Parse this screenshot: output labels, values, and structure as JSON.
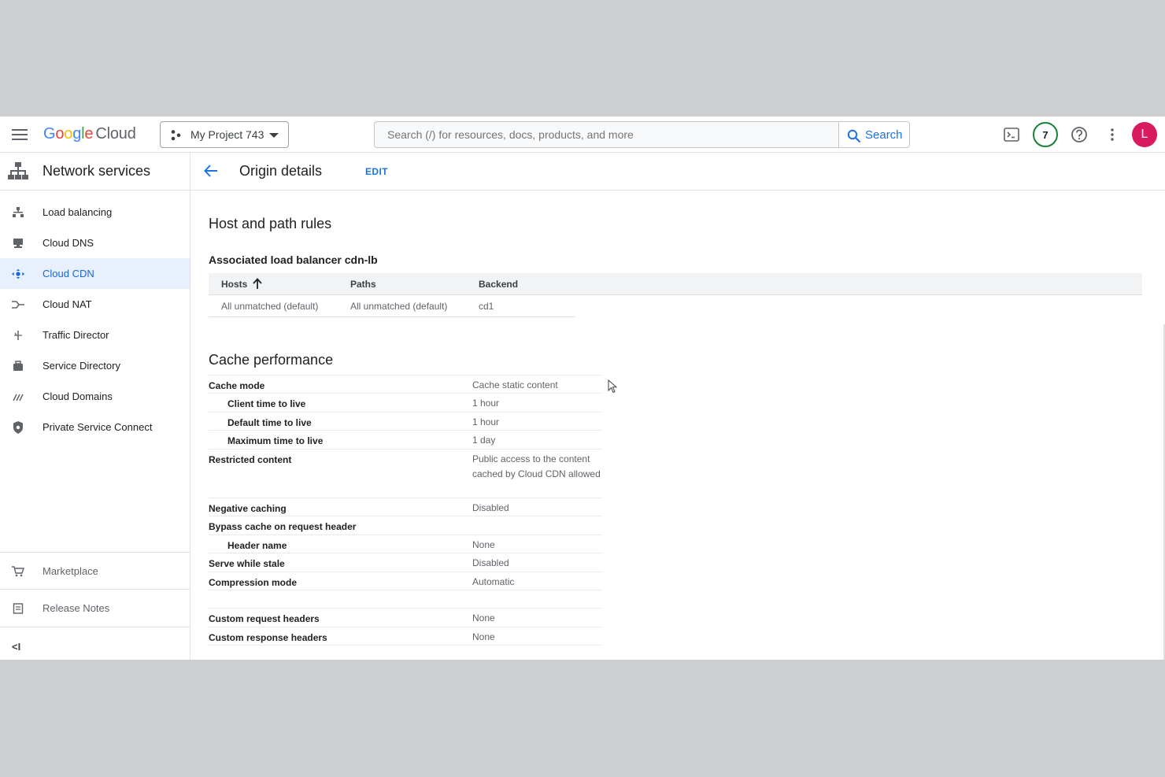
{
  "topbar": {
    "logo": {
      "letters": [
        "G",
        "o",
        "o",
        "g",
        "l",
        "e"
      ],
      "suffix": "Cloud"
    },
    "project_name": "My Project 743",
    "search_placeholder": "Search (/) for resources, docs, products, and more",
    "search_button": "Search",
    "notifications_count": "7",
    "avatar_letter": "L"
  },
  "sidebar": {
    "title": "Network services",
    "items": [
      {
        "label": "Load balancing",
        "icon": "load-balancing-icon"
      },
      {
        "label": "Cloud DNS",
        "icon": "cloud-dns-icon"
      },
      {
        "label": "Cloud CDN",
        "icon": "cloud-cdn-icon",
        "active": true
      },
      {
        "label": "Cloud NAT",
        "icon": "cloud-nat-icon"
      },
      {
        "label": "Traffic Director",
        "icon": "traffic-director-icon"
      },
      {
        "label": "Service Directory",
        "icon": "service-directory-icon"
      },
      {
        "label": "Cloud Domains",
        "icon": "cloud-domains-icon"
      },
      {
        "label": "Private Service Connect",
        "icon": "shield-icon"
      }
    ],
    "bottom_items": [
      {
        "label": "Marketplace",
        "icon": "cart-icon"
      },
      {
        "label": "Release Notes",
        "icon": "notes-icon"
      }
    ],
    "collapse_label": "<I"
  },
  "main": {
    "title": "Origin details",
    "edit_label": "EDIT",
    "host_path": {
      "title": "Host and path rules",
      "lb_label": "Associated load balancer cdn-lb",
      "columns": [
        "Hosts",
        "Paths",
        "Backend"
      ],
      "rows": [
        [
          "All unmatched (default)",
          "All unmatched (default)",
          "cd1"
        ]
      ]
    },
    "cache": {
      "title": "Cache performance",
      "rows": [
        {
          "key": "Cache mode",
          "value": "Cache static content",
          "indent": false
        },
        {
          "key": "Client time to live",
          "value": "1 hour",
          "indent": true
        },
        {
          "key": "Default time to live",
          "value": "1 hour",
          "indent": true
        },
        {
          "key": "Maximum time to live",
          "value": "1 day",
          "indent": true
        },
        {
          "key": "Restricted content",
          "value": "Public access to the content cached by Cloud CDN allowed",
          "indent": false
        },
        {
          "key": "Negative caching",
          "value": "Disabled",
          "indent": false
        },
        {
          "key": "Bypass cache on request header",
          "value": "",
          "indent": false
        },
        {
          "key": "Header name",
          "value": "None",
          "indent": true
        },
        {
          "key": "Serve while stale",
          "value": "Disabled",
          "indent": false
        },
        {
          "key": "Compression mode",
          "value": "Automatic",
          "indent": false
        },
        {
          "key": "",
          "value": "",
          "indent": false
        },
        {
          "key": "Custom request headers",
          "value": "None",
          "indent": false
        },
        {
          "key": "Custom response headers",
          "value": "None",
          "indent": false
        }
      ]
    }
  },
  "colors": {
    "accent": "#1a73e8",
    "active_bg": "#e8f0fe",
    "avatar": "#d81b60",
    "badge_ring": "#188038"
  }
}
